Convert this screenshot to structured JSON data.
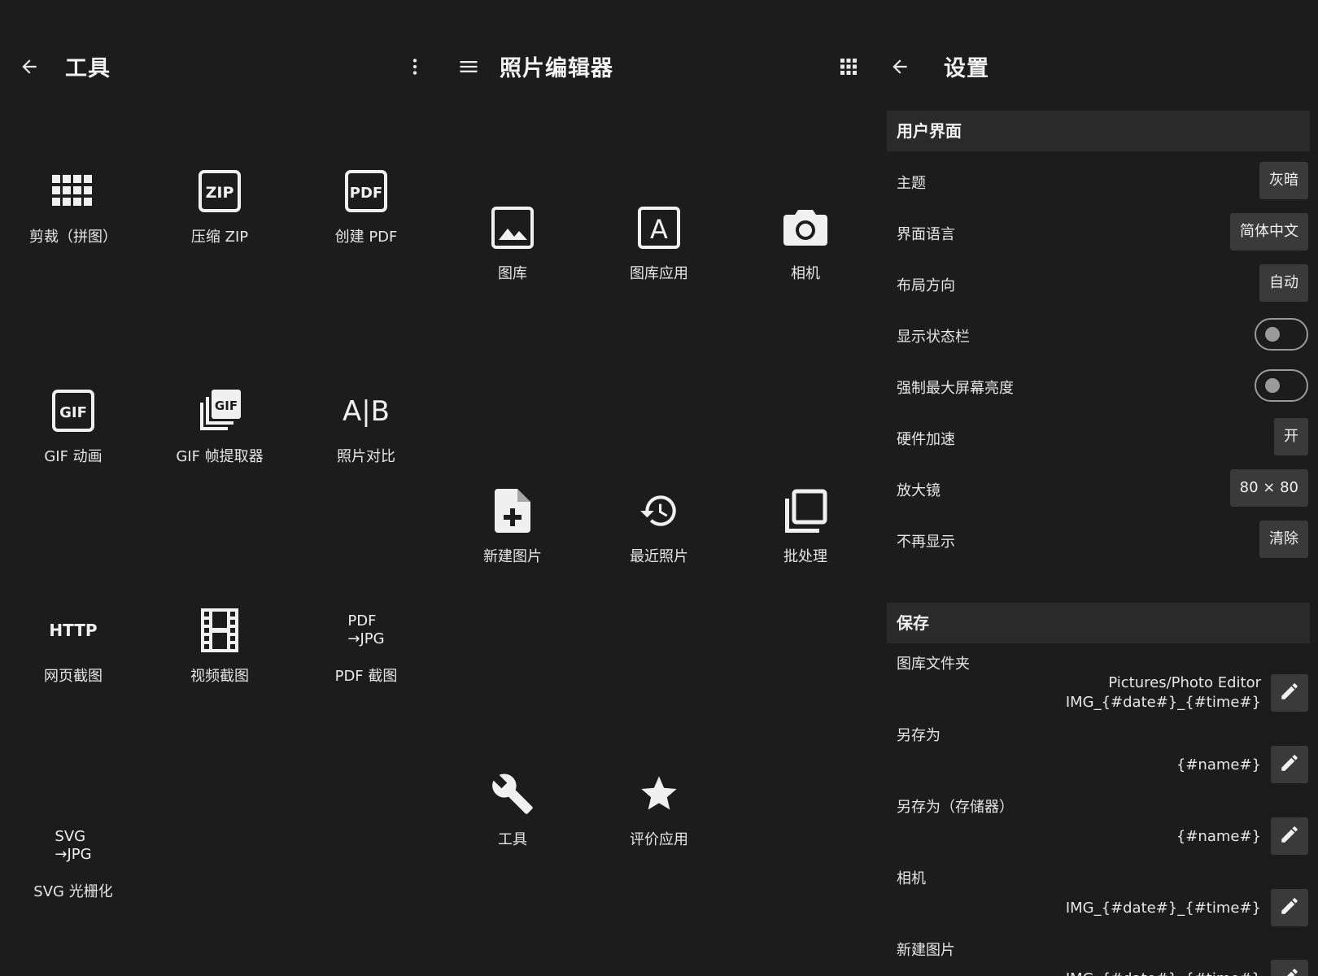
{
  "colors": {
    "background": "#1c1c1d",
    "section_bg": "#2a2a2b",
    "button_bg": "#3a3a3b",
    "text": "#e8e8e8"
  },
  "tools_panel": {
    "title": "工具",
    "back_icon": "arrow-left-icon",
    "menu_icon": "more-vertical-icon",
    "items": [
      {
        "label": "剪裁（拼图）",
        "icon": "grid-collage-icon"
      },
      {
        "label": "压缩 ZIP",
        "icon": "zip-icon",
        "badge": "ZIP"
      },
      {
        "label": "创建 PDF",
        "icon": "pdf-icon",
        "badge": "PDF"
      },
      {
        "label": "GIF 动画",
        "icon": "gif-icon",
        "badge": "GIF"
      },
      {
        "label": "GIF 帧提取器",
        "icon": "gif-frames-icon",
        "badge": "GIF"
      },
      {
        "label": "照片对比",
        "icon": "compare-icon",
        "glyph": "A|B"
      },
      {
        "label": "网页截图",
        "icon": "http-icon",
        "glyph": "HTTP"
      },
      {
        "label": "视频截图",
        "icon": "film-icon"
      },
      {
        "label": "PDF 截图",
        "icon": "pdf-to-jpg-icon",
        "glyph_line1": "PDF",
        "glyph_line2": "→JPG"
      },
      {
        "label": "SVG 光栅化",
        "icon": "svg-to-jpg-icon",
        "glyph_line1": "SVG",
        "glyph_line2": "→JPG"
      }
    ]
  },
  "editor_panel": {
    "title": "照片编辑器",
    "menu_icon": "hamburger-icon",
    "apps_icon": "apps-grid-icon",
    "items": [
      {
        "label": "图库",
        "icon": "gallery-icon"
      },
      {
        "label": "图库应用",
        "icon": "gallery-app-icon",
        "badge": "A"
      },
      {
        "label": "相机",
        "icon": "camera-icon"
      },
      {
        "label": "新建图片",
        "icon": "new-file-icon"
      },
      {
        "label": "最近照片",
        "icon": "history-icon"
      },
      {
        "label": "批处理",
        "icon": "batch-icon"
      },
      {
        "label": "工具",
        "icon": "wrench-icon"
      },
      {
        "label": "评价应用",
        "icon": "star-icon"
      }
    ]
  },
  "settings_panel": {
    "title": "设置",
    "back_icon": "arrow-left-icon",
    "ui_section": {
      "header": "用户界面",
      "rows": [
        {
          "label": "主题",
          "value": "灰暗"
        },
        {
          "label": "界面语言",
          "value": "简体中文"
        },
        {
          "label": "布局方向",
          "value": "自动"
        },
        {
          "label": "显示状态栏",
          "toggle": "off"
        },
        {
          "label": "强制最大屏幕亮度",
          "toggle": "off"
        },
        {
          "label": "硬件加速",
          "value": "开"
        },
        {
          "label": "放大镜",
          "value": "80 × 80"
        },
        {
          "label": "不再显示",
          "value": "清除"
        }
      ]
    },
    "save_section": {
      "header": "保存",
      "rows": [
        {
          "label": "图库文件夹",
          "line1": "Pictures/Photo Editor",
          "line2": "IMG_{#date#}_{#time#}"
        },
        {
          "label": "另存为",
          "line1": "{#name#}"
        },
        {
          "label": "另存为（存储器）",
          "line1": "{#name#}"
        },
        {
          "label": "相机",
          "line1": "IMG_{#date#}_{#time#}"
        },
        {
          "label": "新建图片",
          "line1": "IMG_{#date#}_{#time#}"
        }
      ]
    }
  }
}
